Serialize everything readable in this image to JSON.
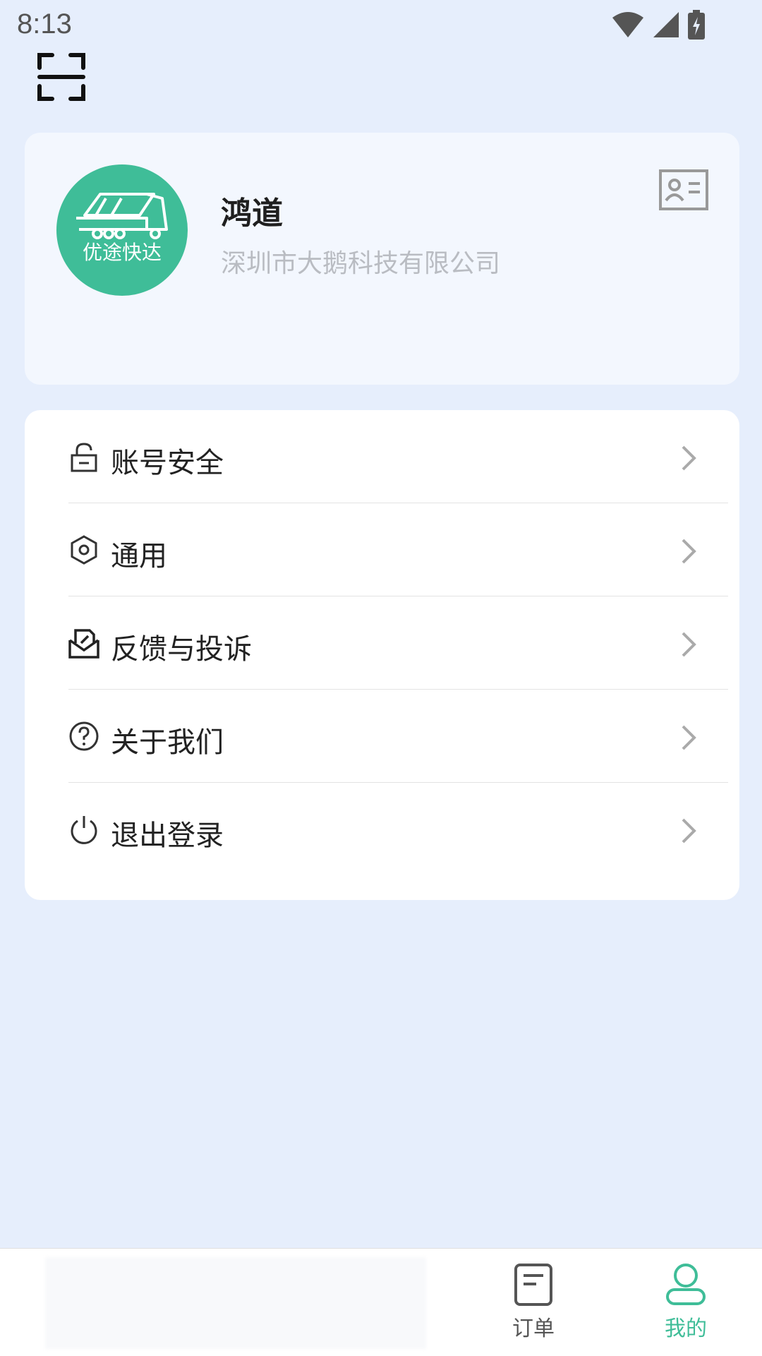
{
  "status_bar": {
    "time": "8:13"
  },
  "profile": {
    "logo_text": "优途快达",
    "name": "鸿道",
    "company": "深圳市大鹅科技有限公司"
  },
  "menu": {
    "items": [
      {
        "label": "账号安全",
        "icon": "lock-icon"
      },
      {
        "label": "通用",
        "icon": "hexagon-settings-icon"
      },
      {
        "label": "反馈与投诉",
        "icon": "feedback-envelope-icon"
      },
      {
        "label": "关于我们",
        "icon": "question-circle-icon"
      },
      {
        "label": "退出登录",
        "icon": "power-icon"
      }
    ]
  },
  "tabs": [
    {
      "label": "订单",
      "icon": "document-icon"
    },
    {
      "label": "我的",
      "icon": "user-icon",
      "active": true
    }
  ],
  "colors": {
    "accent": "#3fbd98",
    "background": "#e6eefc"
  }
}
